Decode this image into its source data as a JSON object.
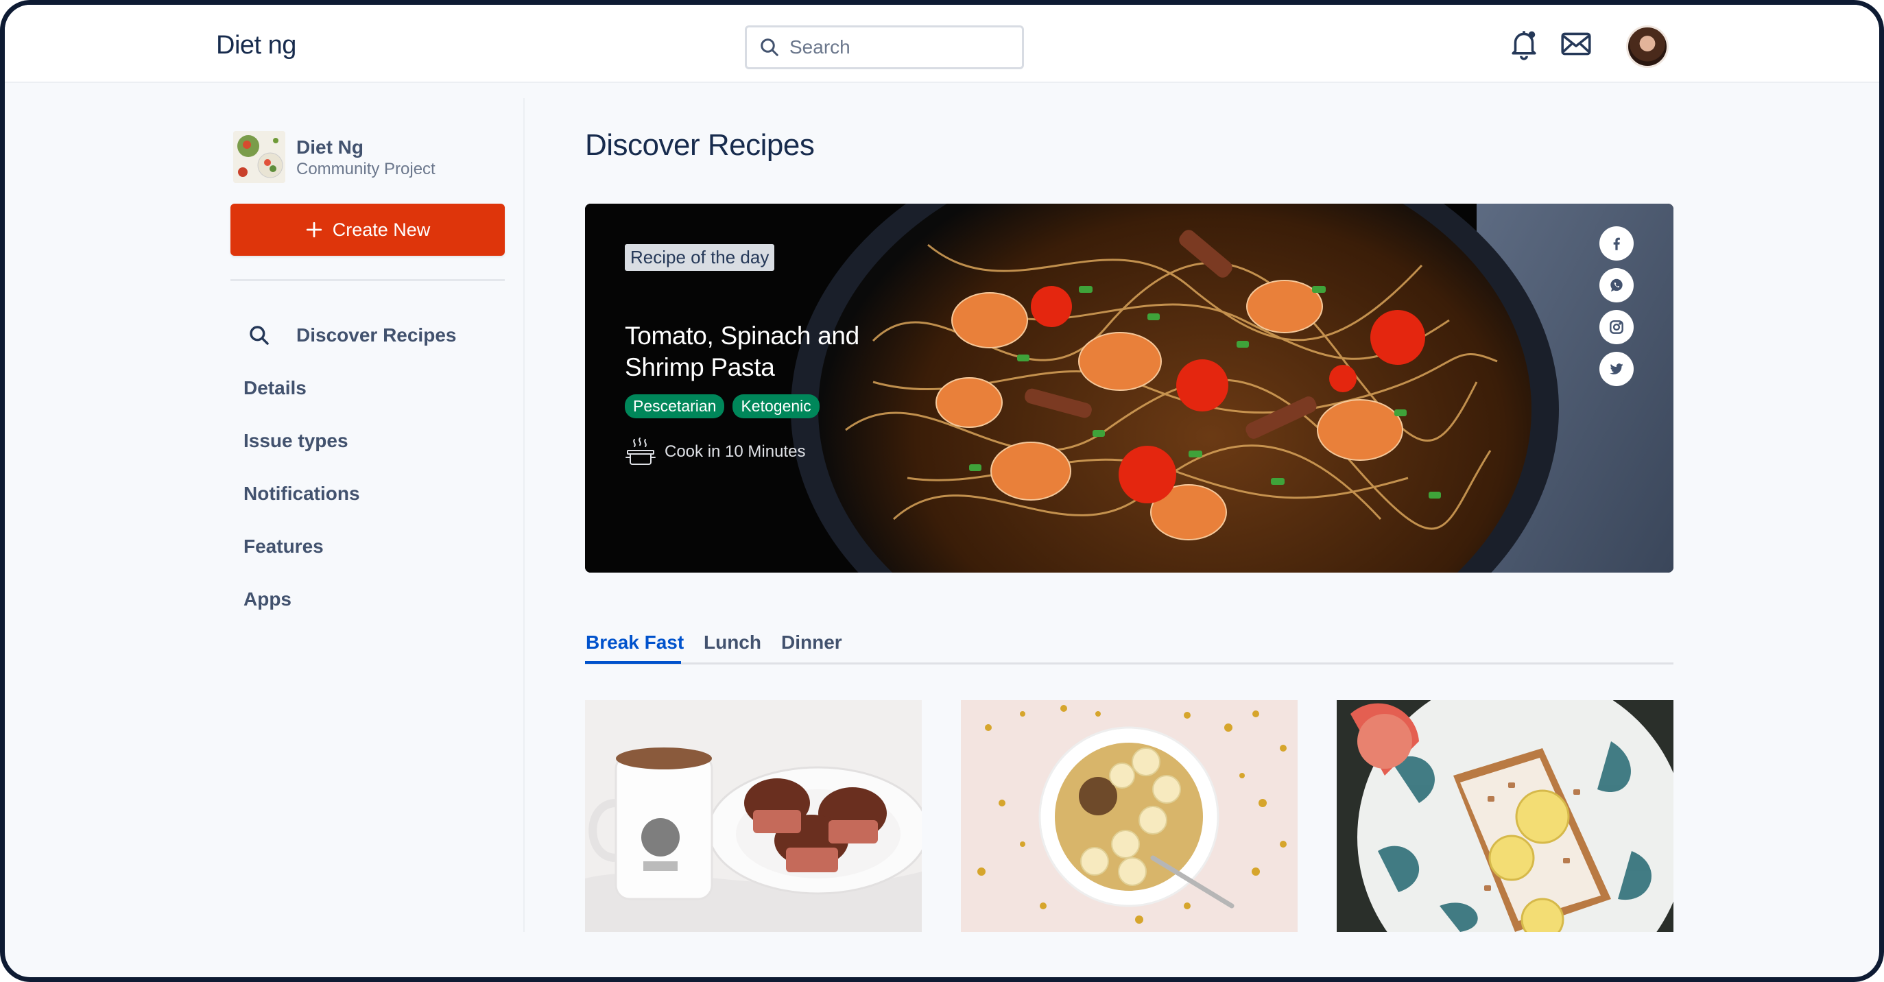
{
  "header": {
    "brand": "Diet ng",
    "search_placeholder": "Search",
    "icons": [
      "search-icon",
      "bell-icon",
      "mail-icon",
      "user-avatar"
    ]
  },
  "sidebar": {
    "project_name": "Diet Ng",
    "project_sub": "Community Project",
    "create_label": "Create New",
    "items": [
      {
        "label": "Discover Recipes",
        "icon": "search-icon"
      },
      {
        "label": "Details"
      },
      {
        "label": "Issue types"
      },
      {
        "label": "Notifications"
      },
      {
        "label": "Features"
      },
      {
        "label": "Apps"
      }
    ]
  },
  "main": {
    "title": "Discover Recipes",
    "hero": {
      "badge": "Recipe of the day",
      "title": "Tomato, Spinach and Shrimp Pasta",
      "tags": [
        "Pescetarian",
        "Ketogenic"
      ],
      "cook_time": "Cook in 10 Minutes",
      "social": [
        "facebook-icon",
        "whatsapp-icon",
        "instagram-icon",
        "twitter-icon"
      ]
    },
    "tabs": [
      "Break Fast",
      "Lunch",
      "Dinner"
    ],
    "active_tab": "Break Fast",
    "cards": [
      "coffee-muffins-photo",
      "banana-oat-bowl-photo",
      "lemon-toast-photo"
    ]
  },
  "colors": {
    "accent": "#de350b",
    "link": "#0052cc",
    "tag": "#00875a",
    "text": "#172b4d"
  }
}
